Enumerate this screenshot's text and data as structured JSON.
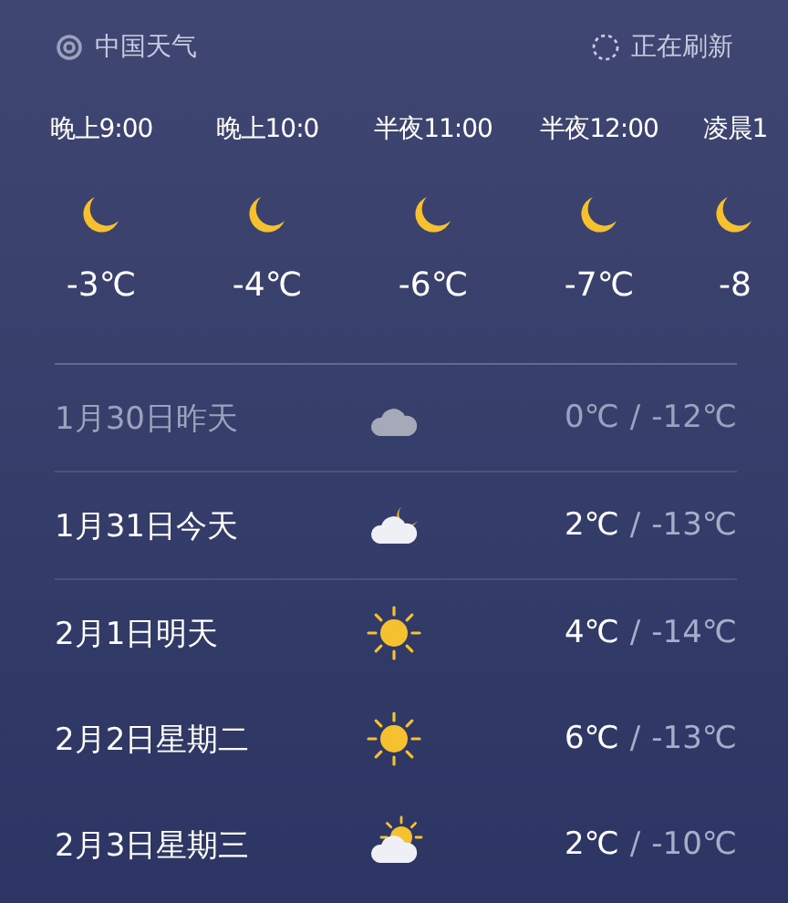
{
  "header": {
    "app_name": "中国天气",
    "status": "正在刷新"
  },
  "hourly": [
    {
      "time": "晚上9:00",
      "kind": "moon",
      "temp": "-3℃"
    },
    {
      "time": "晚上10:0",
      "kind": "moon",
      "temp": "-4℃"
    },
    {
      "time": "半夜11:00",
      "kind": "moon",
      "temp": "-6℃"
    },
    {
      "time": "半夜12:00",
      "kind": "moon",
      "temp": "-7℃"
    },
    {
      "time": "凌晨1",
      "kind": "moon",
      "temp": "-8"
    }
  ],
  "daily": [
    {
      "date": "1月30日昨天",
      "kind": "cloud",
      "high": "0℃",
      "separator": "/",
      "low": "-12℃",
      "past": true
    },
    {
      "date": "1月31日今天",
      "kind": "cloud-moon",
      "high": "2℃",
      "separator": "/",
      "low": "-13℃",
      "past": false
    },
    {
      "date": "2月1日明天",
      "kind": "sun",
      "high": "4℃",
      "separator": "/",
      "low": "-14℃",
      "past": false
    },
    {
      "date": "2月2日星期二",
      "kind": "sun",
      "high": "6℃",
      "separator": "/",
      "low": "-13℃",
      "past": false
    },
    {
      "date": "2月3日星期三",
      "kind": "cloud-sun",
      "high": "2℃",
      "separator": "/",
      "low": "-10℃",
      "past": false
    }
  ]
}
